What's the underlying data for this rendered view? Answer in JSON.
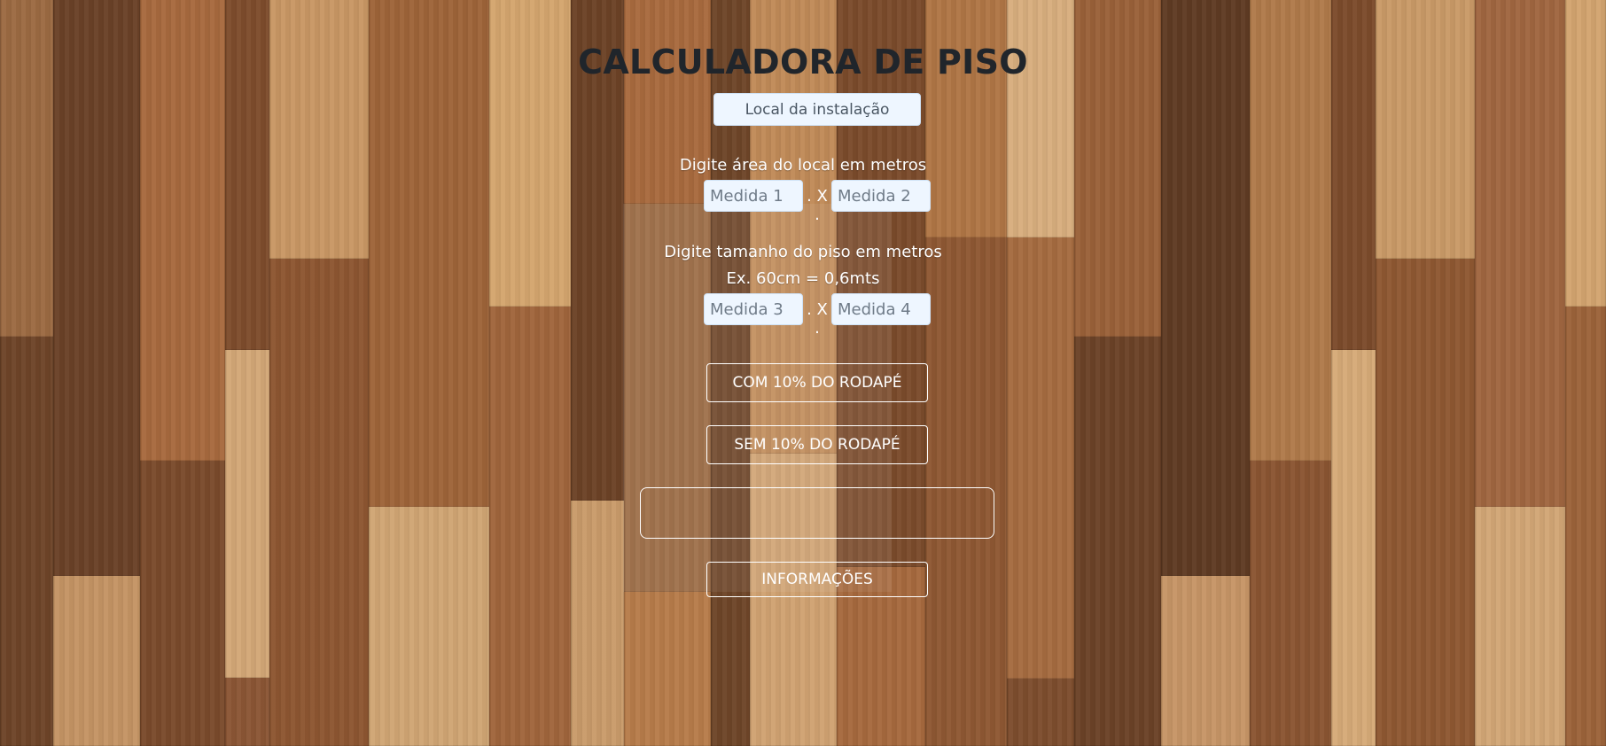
{
  "app": {
    "title": "CALCULADORA DE PISO"
  },
  "install_location": {
    "placeholder": "Local da instalação"
  },
  "area_section": {
    "label": "Digite área do local em metros",
    "measure1_placeholder": "Medida 1",
    "separator": ". X .",
    "measure2_placeholder": "Medida 2"
  },
  "tile_section": {
    "label": "Digite tamanho do piso em metros",
    "example": "Ex. 60cm = 0,6mts",
    "measure3_placeholder": "Medida 3",
    "separator": ". X .",
    "measure4_placeholder": "Medida 4"
  },
  "buttons": {
    "with_baseboard": "COM 10% DO RODAPÉ",
    "without_baseboard": "SEM 10% DO RODAPÉ",
    "info": "INFORMAÇÕES"
  },
  "result": {
    "value": ""
  },
  "colors": {
    "title": "#20252b",
    "input_bg": "#eef6ff",
    "text": "#ffffff"
  }
}
